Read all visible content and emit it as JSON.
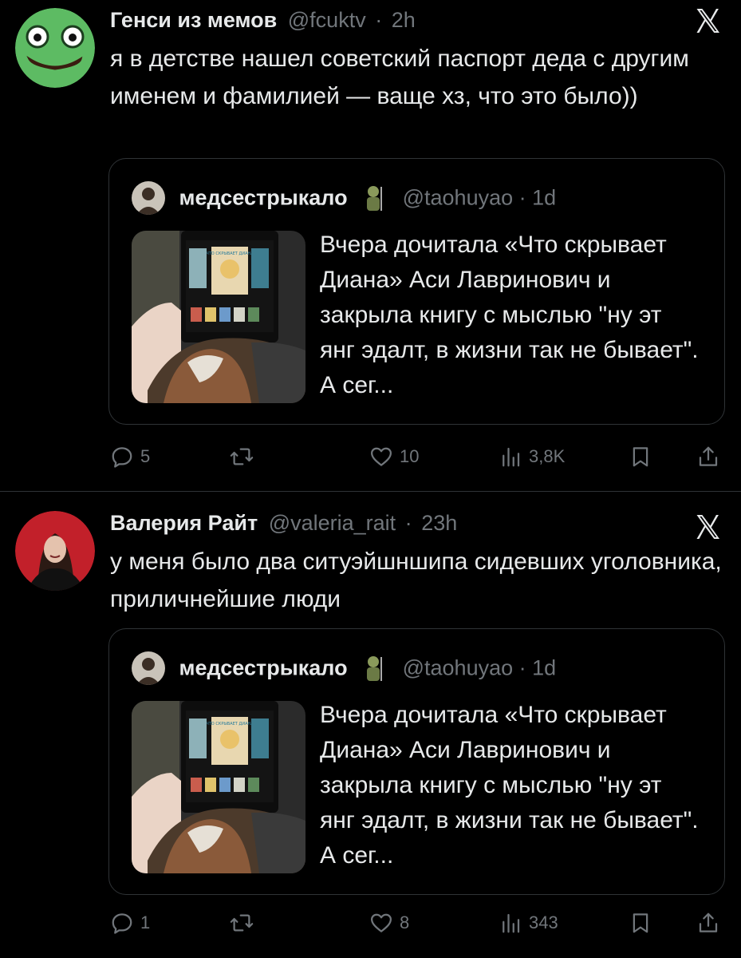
{
  "tweets": [
    {
      "author_name": "Генси из мемов",
      "handle": "@fcuktv",
      "time": "2h",
      "text": "я в детстве нашел советский паспорт деда с другим именем и фамилией — ваще хз, что это было))",
      "quote": {
        "author_name": "медсестрыкало",
        "handle": "@taohuyao",
        "time": "1d",
        "text": "Вчера дочитала «Что скрывает Диана» Аси Лавринович и закрыла книгу с мыслью \"ну эт янг эдалт, в жизни так не бывает\". А сег..."
      },
      "actions": {
        "replies": "5",
        "retweets": "",
        "likes": "10",
        "views": "3,8K"
      }
    },
    {
      "author_name": "Валерия Райт",
      "handle": "@valeria_rait",
      "time": "23h",
      "text": "у меня было два ситуэйшншипа сидевших уголовника, приличнейшие люди",
      "quote": {
        "author_name": "медсестрыкало",
        "handle": "@taohuyao",
        "time": "1d",
        "text": "Вчера дочитала «Что скрывает Диана» Аси Лавринович и закрыла книгу с мыслью \"ну эт янг эдалт, в жизни так не бывает\". А сег..."
      },
      "actions": {
        "replies": "1",
        "retweets": "",
        "likes": "8",
        "views": "343"
      }
    }
  ],
  "separator": "·",
  "book_cover_text": "ЧТО СКРЫВАЕТ ДИАНА",
  "icons": [
    "x-logo-icon",
    "reply-icon",
    "retweet-icon",
    "like-icon",
    "views-icon",
    "bookmark-icon",
    "share-icon"
  ],
  "colors": {
    "background": "#000000",
    "text": "#e7e9ea",
    "muted": "#71767b",
    "border": "#2f3336",
    "frog_green": "#5dbb63"
  }
}
